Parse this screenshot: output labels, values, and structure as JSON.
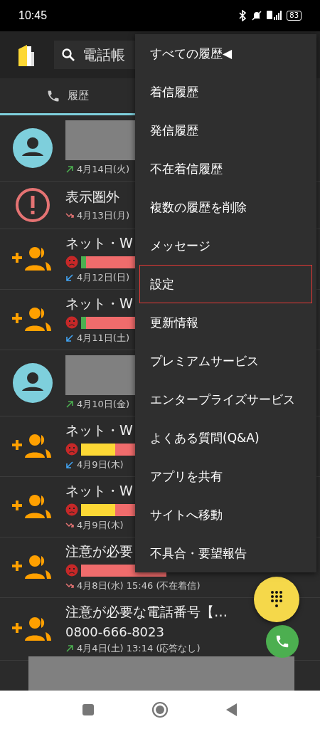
{
  "status_bar": {
    "time": "10:45",
    "battery": "83"
  },
  "app_bar": {
    "search": {
      "placeholder": "電話帳"
    }
  },
  "tabs": [
    {
      "label": "履歴",
      "selected": true
    }
  ],
  "calls": [
    {
      "avatar": {
        "kind": "contact"
      },
      "redacted": true,
      "direction": {
        "kind": "outgoing"
      },
      "date": "4月14日(火)"
    },
    {
      "avatar": {
        "kind": "warning"
      },
      "name": "表示圏外",
      "direction": {
        "kind": "missed"
      },
      "date": "4月13日(月)"
    },
    {
      "avatar": {
        "kind": "add"
      },
      "name": "ネット・W",
      "meter": {
        "level": 0.94,
        "color": "#4caf50"
      },
      "direction": {
        "kind": "incoming"
      },
      "date": "4月12日(日)"
    },
    {
      "avatar": {
        "kind": "add"
      },
      "name": "ネット・W",
      "meter": {
        "level": 0.94,
        "color": "#4caf50"
      },
      "direction": {
        "kind": "incoming"
      },
      "date": "4月11日(土)"
    },
    {
      "avatar": {
        "kind": "contact"
      },
      "redacted": true,
      "direction": {
        "kind": "outgoing"
      },
      "date": "4月10日(金)"
    },
    {
      "avatar": {
        "kind": "add"
      },
      "name": "ネット・W",
      "meter": {
        "level": 0.6,
        "color": "#fdd835"
      },
      "direction": {
        "kind": "incoming"
      },
      "date": "4月9日(木)"
    },
    {
      "avatar": {
        "kind": "add"
      },
      "name": "ネット・W",
      "meter": {
        "level": 0.6,
        "color": "#fdd835"
      },
      "direction": {
        "kind": "missed"
      },
      "date": "4月9日(木)"
    },
    {
      "avatar": {
        "kind": "add"
      },
      "name": "注意が必要",
      "meter": {
        "level": 1
      },
      "direction": {
        "kind": "missed"
      },
      "date": "4月8日(水) 15:46 (不在着信)"
    },
    {
      "avatar": {
        "kind": "add"
      },
      "name": "注意が必要な電話番号【…",
      "number": "0800-666-8023",
      "direction": {
        "kind": "outgoing"
      },
      "date": "4月4日(土) 13:14 (応答なし)"
    }
  ],
  "menu": {
    "items": [
      {
        "label": "すべての履歴◀",
        "selected": false
      },
      {
        "label": "着信履歴",
        "selected": false
      },
      {
        "label": "発信履歴",
        "selected": false
      },
      {
        "label": "不在着信履歴",
        "selected": false
      },
      {
        "label": "複数の履歴を削除",
        "selected": false
      },
      {
        "label": "メッセージ",
        "selected": false
      },
      {
        "label": "設定",
        "selected": true
      },
      {
        "label": "更新情報",
        "selected": false
      },
      {
        "label": "プレミアムサービス",
        "selected": false
      },
      {
        "label": "エンタープライズサービス",
        "selected": false
      },
      {
        "label": "よくある質問(Q&A)",
        "selected": false
      },
      {
        "label": "アプリを共有",
        "selected": false
      },
      {
        "label": "サイトへ移動",
        "selected": false
      },
      {
        "label": "不具合・要望報告",
        "selected": false
      }
    ]
  }
}
